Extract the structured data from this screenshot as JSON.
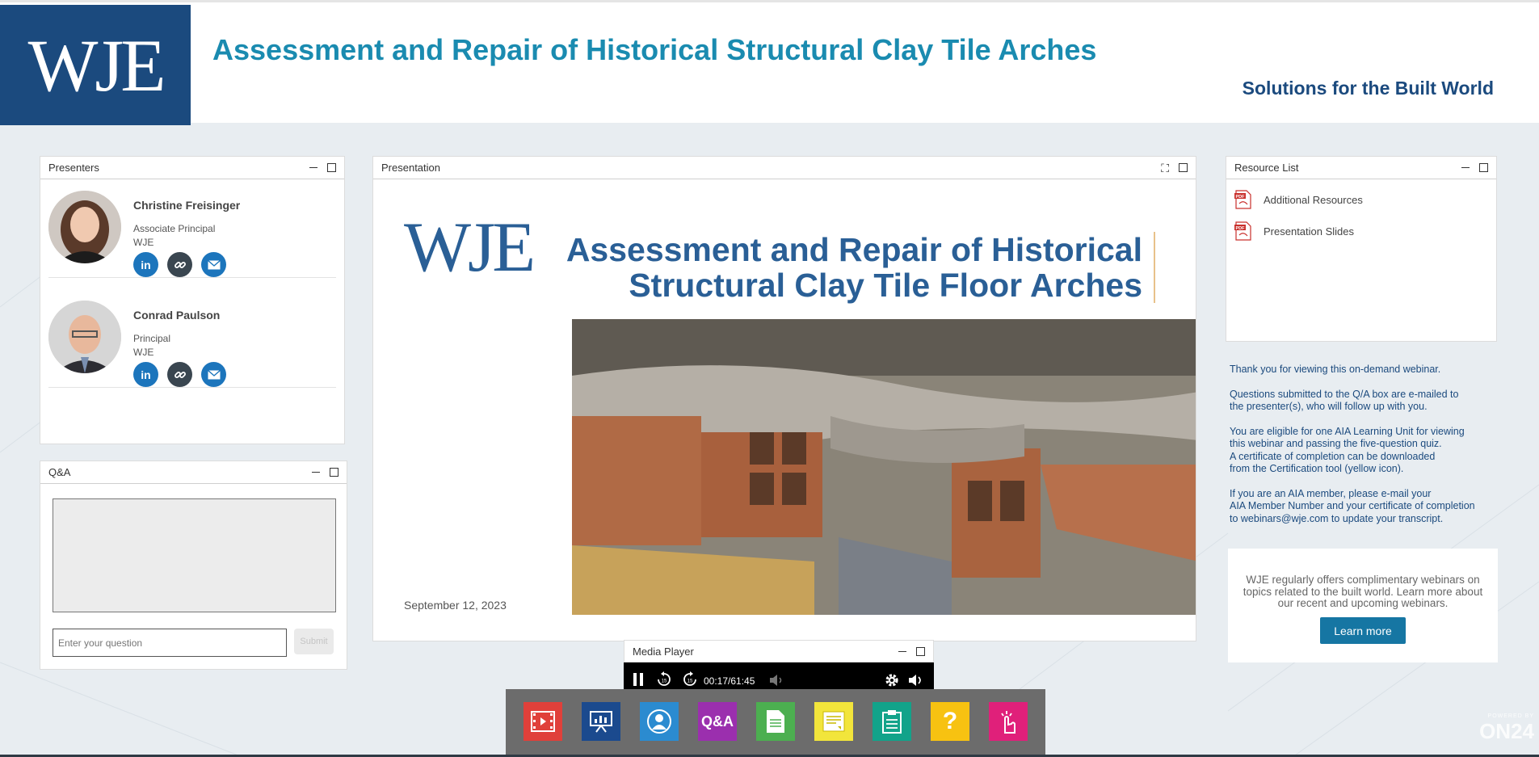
{
  "header": {
    "logo": "WJE",
    "title": "Assessment and Repair of Historical Structural Clay Tile Arches",
    "tagline": "Solutions for the Built World"
  },
  "presenters_panel": {
    "title": "Presenters",
    "presenters": [
      {
        "name": "Christine Freisinger",
        "role": "Associate Principal",
        "org": "WJE"
      },
      {
        "name": "Conrad Paulson",
        "role": "Principal",
        "org": "WJE"
      }
    ]
  },
  "qa_panel": {
    "title": "Q&A",
    "input_placeholder": "Enter your question",
    "submit_label": "Submit"
  },
  "presentation_panel": {
    "title": "Presentation",
    "slide": {
      "logo": "WJE",
      "title_line1": "Assessment and Repair of Historical",
      "title_line2": "Structural Clay Tile Floor Arches",
      "date": "September 12, 2023"
    }
  },
  "resource_panel": {
    "title": "Resource List",
    "items": [
      {
        "label": "Additional Resources"
      },
      {
        "label": "Presentation Slides"
      }
    ]
  },
  "info": {
    "p1": "Thank you for viewing this on-demand webinar.",
    "p2_l1": "Questions submitted to the Q/A box are e-mailed to",
    "p2_l2": "the presenter(s), who will follow up with you.",
    "p3_l1": "You are eligible for one AIA Learning Unit for viewing",
    "p3_l2": "this webinar and passing the five-question quiz.",
    "p3_l3": "A certificate of completion can be downloaded",
    "p3_l4": "from the Certification tool (yellow icon).",
    "p4_l1": "If you are an AIA member, please e-mail your",
    "p4_l2": "AIA Member Number and your certificate of completion",
    "p4_l3": "to webinars@wje.com to update your transcript."
  },
  "promo": {
    "text": "WJE regularly offers complimentary webinars on topics related to the built world. Learn more about our recent and upcoming webinars.",
    "button": "Learn more"
  },
  "media_player": {
    "title": "Media Player",
    "time": "00:17/61:45",
    "progress": 0.005
  },
  "toolbar": {
    "qa_label": "Q&A",
    "help_label": "?",
    "colors": {
      "media": "#e0403a",
      "slides": "#1b4a8e",
      "presenters": "#2b8bd0",
      "qa": "#9b2fae",
      "resources": "#4caf50",
      "notes": "#f2e53b",
      "certification": "#12a38a",
      "help": "#f7c211",
      "survey": "#e0207a"
    }
  },
  "branding": {
    "powered_by": "POWERED BY",
    "vendor": "ON24"
  },
  "colors": {
    "brand_navy": "#1b4a7e",
    "title_teal": "#1a8bb0",
    "button_blue": "#1676a3"
  }
}
